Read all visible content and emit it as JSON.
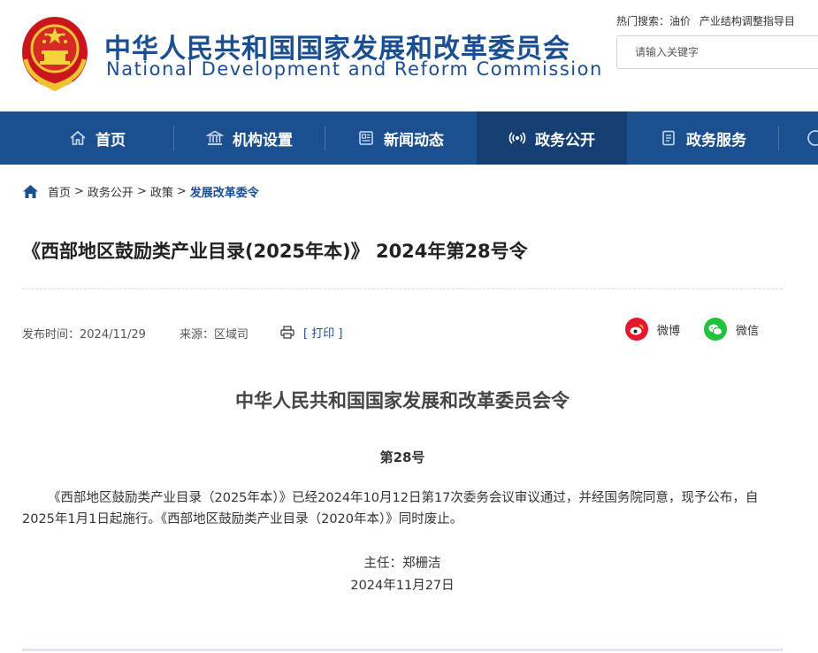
{
  "header": {
    "site_name_cn": "中华人民共和国国家发展和改革委员会",
    "site_name_en": "National Development and Reform Commission",
    "hot_search_label": "热门搜索：",
    "hot_search_terms": [
      "油价",
      "产业结构调整指导目"
    ],
    "search_placeholder": "请输入关键字"
  },
  "nav": {
    "items": [
      {
        "label": "首页",
        "icon": "home-icon"
      },
      {
        "label": "机构设置",
        "icon": "building-icon"
      },
      {
        "label": "新闻动态",
        "icon": "newspaper-icon"
      },
      {
        "label": "政务公开",
        "icon": "broadcast-icon",
        "active": true
      },
      {
        "label": "政务服务",
        "icon": "document-icon"
      }
    ]
  },
  "breadcrumb": {
    "items": [
      "首页",
      "政务公开",
      "政策"
    ],
    "separator": ">",
    "current": "发展改革委令"
  },
  "article": {
    "title": "《西部地区鼓励类产业目录(2025年本)》 2024年第28号令",
    "publish_time": "发布时间：2024/11/29",
    "source": "来源：区域司",
    "print_label": "[ 打印 ]",
    "share": {
      "weibo": "微博",
      "wechat": "微信"
    },
    "heading": "中华人民共和国国家发展和改革委员会令",
    "number": "第28号",
    "body": "《西部地区鼓励类产业目录（2025年本）》已经2024年10月12日第17次委务会议审议通过，并经国务院同意，现予公布，自2025年1月1日起施行。《西部地区鼓励类产业目录（2020年本）》同时废止。",
    "signer": "主任：郑栅洁",
    "date": "2024年11月27日"
  },
  "colors": {
    "brand_blue": "#1b4f8f",
    "nav_active": "#163f73",
    "weibo_red": "#e6162d",
    "wechat_green": "#20c33a"
  }
}
